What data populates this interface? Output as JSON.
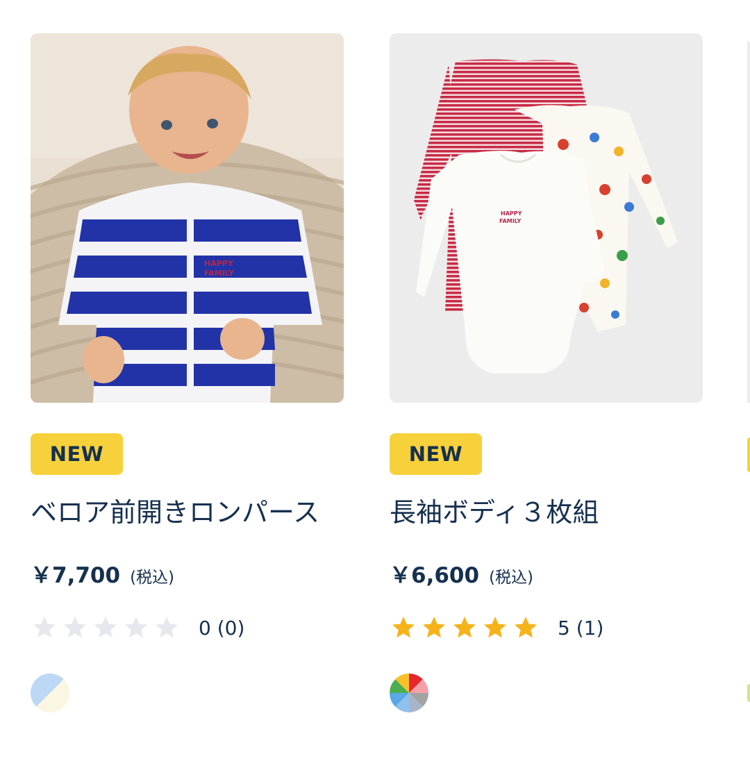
{
  "products": [
    {
      "badge": "NEW",
      "title": "ベロア前開きロンパース",
      "price": "￥7,700",
      "tax_label": "(税込)",
      "rating": 0,
      "rating_text": "0 (0)",
      "image_alt": "baby in blue and white striped velour romper",
      "swatch_colors": [
        "#bcd8f5",
        "#fbf6e2"
      ]
    },
    {
      "badge": "NEW",
      "title": "長袖ボディ３枚組",
      "price": "￥6,600",
      "tax_label": "(税込)",
      "rating": 5,
      "rating_text": "5 (1)",
      "image_alt": "three long-sleeve bodysuits: red stripe, white, and printed",
      "swatch_colors": [
        "#e8262b",
        "#f5a0a8",
        "#a3a3a3",
        "#a8b4c8",
        "#8ec2ee",
        "#5aa8e6",
        "#4cae4f",
        "#f7c12b"
      ]
    }
  ],
  "colors": {
    "badge_bg": "#f7d13b",
    "text": "#16304f",
    "star_filled": "#f6b319",
    "star_empty": "#e6e8ed",
    "image_bg_2": "#ececec"
  },
  "icons": {
    "star": "star-icon"
  }
}
